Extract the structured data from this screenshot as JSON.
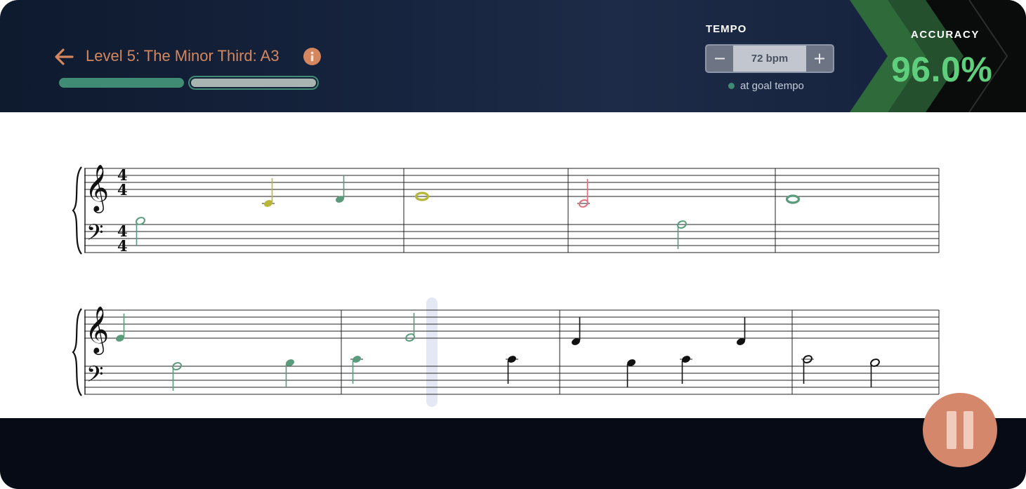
{
  "header": {
    "level_title": "Level 5: The Minor Third: A3",
    "back_icon": "arrow-left-icon",
    "info_icon": "info-icon",
    "progress": {
      "segments": 2,
      "completed": 1,
      "current": 2
    }
  },
  "tempo": {
    "label": "TEMPO",
    "value": "72 bpm",
    "minus_label": "−",
    "plus_label": "+",
    "status": "at goal tempo"
  },
  "accuracy": {
    "label": "ACCURACY",
    "value": "96.0%"
  },
  "score": {
    "time_signature": [
      "4",
      "4"
    ],
    "clefs": [
      "treble",
      "bass"
    ],
    "note_colors": {
      "correct": "#5a9b7c",
      "early_late": "#b8b636",
      "wrong": "#e36d78",
      "upcoming": "#111111"
    },
    "playhead_color": "#e3e8f4"
  },
  "footer": {
    "pause_icon": "pause-icon"
  },
  "colors": {
    "accent": "#d4875f",
    "progress_green": "#3f8b73",
    "accuracy_green": "#5fcf7d"
  }
}
